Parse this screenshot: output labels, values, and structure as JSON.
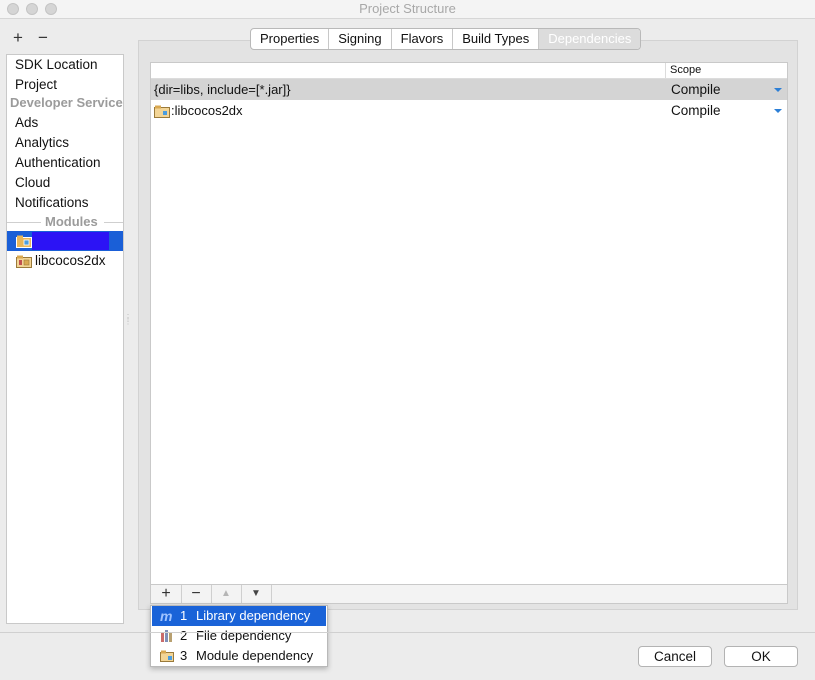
{
  "window": {
    "title": "Project Structure"
  },
  "left_toolbar": {
    "add": "+",
    "remove": "−"
  },
  "sidebar": {
    "items": [
      {
        "label": "SDK Location"
      },
      {
        "label": "Project"
      }
    ],
    "developer_services_header": "Developer Services",
    "services": [
      {
        "label": "Ads"
      },
      {
        "label": "Analytics"
      },
      {
        "label": "Authentication"
      },
      {
        "label": "Cloud"
      },
      {
        "label": "Notifications"
      }
    ],
    "modules_header": "Modules",
    "modules": [
      {
        "label": "",
        "selected": true
      },
      {
        "label": "libcocos2dx"
      }
    ]
  },
  "tabs": [
    {
      "label": "Properties"
    },
    {
      "label": "Signing"
    },
    {
      "label": "Flavors"
    },
    {
      "label": "Build Types"
    },
    {
      "label": "Dependencies",
      "active": true
    }
  ],
  "dependencies_table": {
    "scope_header": "Scope",
    "rows": [
      {
        "name": "{dir=libs, include=[*.jar]}",
        "scope": "Compile",
        "selected": true
      },
      {
        "name": ":libcocos2dx",
        "scope": "Compile",
        "icon": "module-folder-icon"
      }
    ]
  },
  "table_toolbar": {
    "add": "+",
    "remove": "−",
    "up": "▲",
    "down": "▼"
  },
  "add_popup": {
    "items": [
      {
        "num": "1",
        "label": "Library dependency",
        "icon": "library-m-icon",
        "highlighted": true
      },
      {
        "num": "2",
        "label": "File dependency",
        "icon": "file-jar-icon"
      },
      {
        "num": "3",
        "label": "Module dependency",
        "icon": "module-folder-icon"
      }
    ]
  },
  "buttons": {
    "cancel": "Cancel",
    "ok": "OK"
  },
  "colors": {
    "selection": "#1a63d8",
    "accent_arrow": "#2c7fd6"
  }
}
